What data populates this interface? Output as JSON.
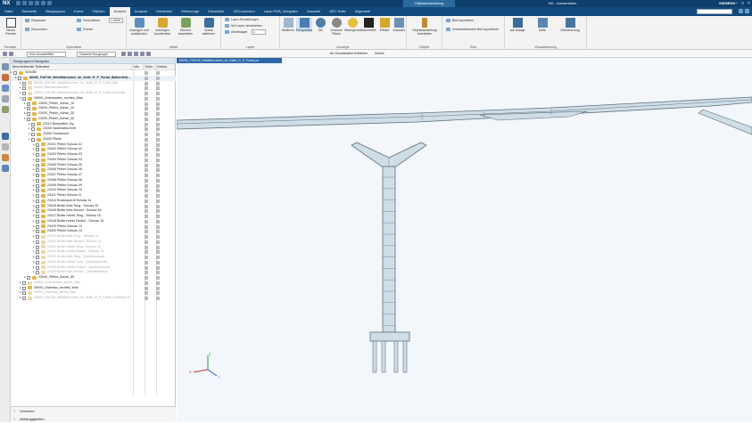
{
  "app": {
    "logo": "NX",
    "title": "NX - Konstruktion",
    "brand": "SIEMENS",
    "context_tab": "Objektbearbeitung",
    "window_controls": [
      "–",
      "□",
      "×"
    ]
  },
  "menu_tabs": [
    "Datei",
    "Startseite",
    "Baugruppen",
    "Kurve",
    "Flächen",
    "Ansicht",
    "Analyse",
    "Darstellen",
    "Werkzeuge",
    "Entwickler",
    "3DConnexion",
    "Laser RVA_Integrator",
    "Auswahl",
    "AEC Suite",
    "Allgemein"
  ],
  "active_tab": "Ansicht",
  "ribbon": {
    "groups": [
      {
        "label": "Fenster",
        "buttons": [
          "Neues Fenster"
        ]
      },
      {
        "label": "Operation",
        "buttons": [
          "Einpassen",
          "Einzoomen",
          "Verschieben",
          "Drehen"
        ],
        "fields": [
          "1,0000"
        ]
      },
      {
        "label": "Inhalt",
        "buttons": [
          "Anzeigen und ausblenden",
          "Sofortiges Ausblenden",
          "Ebenen bearbeiten",
          "Sowie ablehnen"
        ]
      },
      {
        "label": "Layer",
        "buttons": [
          "Layer-Einstellungen",
          "Auf Layer verschieben",
          "Arbeitslayer"
        ],
        "fields": [
          "1"
        ]
      },
      {
        "label": "Anzeige",
        "buttons": [
          "Stallieren",
          "Perspektive",
          "Stil",
          "Ordnerin Fläche",
          "Hintergrund",
          "Beschriften",
          "Effekte",
          "Auswahl"
        ]
      },
      {
        "label": "Objekt",
        "buttons": [
          "Objektdarstellung bearbeiten"
        ]
      },
      {
        "label": "Bild",
        "buttons": [
          "Bild exportieren",
          "Hochauflösendes Bild exportieren"
        ]
      },
      {
        "label": "Visualisierung",
        "buttons": [
          "wie Ablage",
          "Stifte",
          "Zeitsteuerung"
        ]
      }
    ]
  },
  "selection_bar": {
    "filter1": "Kein Auswahlfilter",
    "filter2": "Gesamte Baugruppe",
    "hint": "Ab Grundansicht fortfahren",
    "hint2": "Zurück"
  },
  "navigator": {
    "title": "Baugruppen-Navigator",
    "columns": [
      "Beschreibender Teilename",
      "Info",
      "Sche...",
      "Geänd..."
    ],
    "rows": [
      {
        "text": "Schnitte",
        "indent": 0,
        "dim": false
      },
      {
        "text": "86000_F28749_Weidthbrocken_im_Seite_R_P_Fortal_Balkenfeld...",
        "indent": 1,
        "dim": false,
        "bold": true
      },
      {
        "text": "20000_F28749_Weidthbrocken_im_Seite_R_P_Fortal_Bkg",
        "indent": 2,
        "dim": true
      },
      {
        "text": "25000_Bauwerksachsen",
        "indent": 2,
        "dim": true
      },
      {
        "text": "30000_F28749_Weidthbrocken_im_Seite_R_P_Fortal_Kontrolle",
        "indent": 2,
        "dim": true
      },
      {
        "text": "26000_Unterbauten_rechtes_Wan",
        "indent": 2,
        "dim": false
      },
      {
        "text": "23000_Pfeiler_Achse_10",
        "indent": 3,
        "dim": false
      },
      {
        "text": "23000_Pfeiler_Achse_20",
        "indent": 3,
        "dim": false
      },
      {
        "text": "23000_Pfeiler_Achse_30",
        "indent": 3,
        "dim": false
      },
      {
        "text": "23000_Pfeiler_Achse_40",
        "indent": 3,
        "dim": false
      },
      {
        "text": "23110 Bohrpfahle_Eg",
        "indent": 4,
        "dim": false
      },
      {
        "text": "23200 Saulenabschnitt",
        "indent": 4,
        "dim": false
      },
      {
        "text": "23300 Fundament",
        "indent": 4,
        "dim": false
      },
      {
        "text": "23400 Pfeiler",
        "indent": 4,
        "dim": false
      },
      {
        "text": "23401 Pfeiler Schuss 01",
        "indent": 5,
        "dim": false
      },
      {
        "text": "23402 Pfeiler Schuss 02",
        "indent": 5,
        "dim": false
      },
      {
        "text": "23403 Pfeiler Schuss 03",
        "indent": 5,
        "dim": false
      },
      {
        "text": "23404 Pfeiler Schuss 04",
        "indent": 5,
        "dim": false
      },
      {
        "text": "23405 Pfeiler Schuss 05",
        "indent": 5,
        "dim": false
      },
      {
        "text": "23406 Pfeiler Schuss 06",
        "indent": 5,
        "dim": false
      },
      {
        "text": "23407 Pfeiler Schuss 07",
        "indent": 5,
        "dim": false
      },
      {
        "text": "23408 Pfeiler Schuss 08",
        "indent": 5,
        "dim": false
      },
      {
        "text": "23409 Pfeiler Schuss 09",
        "indent": 5,
        "dim": false
      },
      {
        "text": "23410 Pfeiler Schuss 10",
        "indent": 5,
        "dim": false
      },
      {
        "text": "23411 Pfeiler Schuss 11",
        "indent": 5,
        "dim": false
      },
      {
        "text": "23414 Endanquerdt Schuss 14",
        "indent": 5,
        "dim": false
      },
      {
        "text": "23415 Breite links Teug - Schuss 15",
        "indent": 5,
        "dim": false
      },
      {
        "text": "23416 Breite links Deckel - Schuss 16",
        "indent": 5,
        "dim": false
      },
      {
        "text": "23417 Breite rechts Teug - Schuss 15",
        "indent": 5,
        "dim": false
      },
      {
        "text": "23418 Breite rechts Deckel - Schuss 16",
        "indent": 5,
        "dim": false
      },
      {
        "text": "23419 Pfeiler Schuss 12",
        "indent": 5,
        "dim": false
      },
      {
        "text": "23420 Pfeiler Schuss 13",
        "indent": 5,
        "dim": false
      },
      {
        "text": "23419 Breite links Teug - Schuss 16",
        "indent": 5,
        "dim": true
      },
      {
        "text": "23420 Breite links Deckel - Schuss 16",
        "indent": 5,
        "dim": true
      },
      {
        "text": "23421 Breite rechts Teug - Schuss 16",
        "indent": 5,
        "dim": true
      },
      {
        "text": "23422 Breite rechts Deckel - Schuss 16",
        "indent": 5,
        "dim": true
      },
      {
        "text": "23423 Breite links Teug - Querbeschluss",
        "indent": 5,
        "dim": true
      },
      {
        "text": "23424 Breite rechts Teug - Querbeschluss",
        "indent": 5,
        "dim": true
      },
      {
        "text": "23425 Breite rechts Deckel - Querbeschluss",
        "indent": 5,
        "dim": true
      },
      {
        "text": "23426 Breite links Deckel - Querbeschluss",
        "indent": 5,
        "dim": true
      },
      {
        "text": "23000_Pfeiler_Achse_50",
        "indent": 3,
        "dim": false
      },
      {
        "text": "24000_Unterbauten_linkes_Wan",
        "indent": 2,
        "dim": true
      },
      {
        "text": "40000_Unterbau_rechtes_Wan",
        "indent": 2,
        "dim": false
      },
      {
        "text": "30000_Unterbau_linkes_Wan",
        "indent": 2,
        "dim": true
      },
      {
        "text": "99000_F28749_Weidthbrocken_im_Seite_R_P_Fortal_Lichtraum RVA",
        "indent": 2,
        "dim": true
      }
    ],
    "bottom": [
      "Vorschau",
      "Abhängigkeiten"
    ]
  },
  "viewport": {
    "tab_label": "86000_F28749_Weidthbrocken_im_Seite_R_P_Fortal.prt",
    "triad": {
      "x": "X",
      "y": "Y",
      "z": "Z"
    }
  },
  "colors": {
    "titlebar": "#0e3e6c",
    "tabs": "#12497c",
    "viewport_bg": "#f3f6fa",
    "model_fill": "#cfdde6",
    "model_stroke": "#5f7380"
  }
}
